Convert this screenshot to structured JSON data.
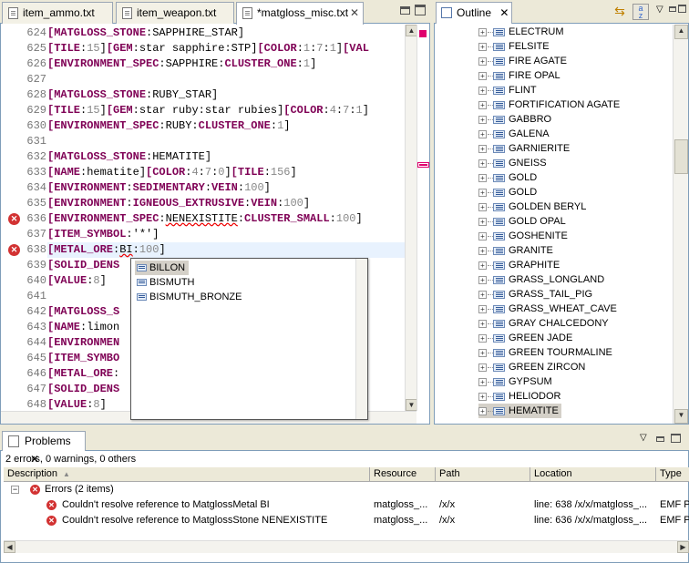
{
  "editor": {
    "tabs": [
      {
        "label": "item_ammo.txt"
      },
      {
        "label": "item_weapon.txt"
      },
      {
        "label": "*matgloss_misc.txt"
      }
    ],
    "lines": [
      {
        "n": "624",
        "html": "<span class=\"kw\">[MATGLOSS_STONE</span>:SAPPHIRE_STAR]"
      },
      {
        "n": "625",
        "html": "<span class=\"kw\">[TILE</span>:<span class=\"num\">15</span>]<span class=\"kw\">[GEM</span>:star sapphire:STP]<span class=\"kw\">[COLOR</span>:<span class=\"num\">1</span>:<span class=\"num\">7</span>:<span class=\"num\">1</span>]<span class=\"kw\">[VAL</span>"
      },
      {
        "n": "626",
        "html": "<span class=\"kw\">[ENVIRONMENT_SPEC</span>:SAPPHIRE:<span class=\"kw\">CLUSTER_ONE</span>:<span class=\"num\">1</span>]"
      },
      {
        "n": "627",
        "html": ""
      },
      {
        "n": "628",
        "html": "<span class=\"kw\">[MATGLOSS_STONE</span>:RUBY_STAR]"
      },
      {
        "n": "629",
        "html": "<span class=\"kw\">[TILE</span>:<span class=\"num\">15</span>]<span class=\"kw\">[GEM</span>:star ruby:star rubies]<span class=\"kw\">[COLOR</span>:<span class=\"num\">4</span>:<span class=\"num\">7</span>:<span class=\"num\">1</span>]"
      },
      {
        "n": "630",
        "html": "<span class=\"kw\">[ENVIRONMENT_SPEC</span>:RUBY:<span class=\"kw\">CLUSTER_ONE</span>:<span class=\"num\">1</span>]"
      },
      {
        "n": "631",
        "html": ""
      },
      {
        "n": "632",
        "html": "<span class=\"kw\">[MATGLOSS_STONE</span>:HEMATITE]"
      },
      {
        "n": "633",
        "html": "<span class=\"kw\">[NAME</span>:hematite]<span class=\"kw\">[COLOR</span>:<span class=\"num\">4</span>:<span class=\"num\">7</span>:<span class=\"num\">0</span>]<span class=\"kw\">[TILE</span>:<span class=\"num\">156</span>]"
      },
      {
        "n": "634",
        "html": "<span class=\"kw\">[ENVIRONMENT</span>:<span class=\"kw\">SEDIMENTARY</span>:<span class=\"kw\">VEIN</span>:<span class=\"num\">100</span>]"
      },
      {
        "n": "635",
        "html": "<span class=\"kw\">[ENVIRONMENT</span>:<span class=\"kw\">IGNEOUS_EXTRUSIVE</span>:<span class=\"kw\">VEIN</span>:<span class=\"num\">100</span>]"
      },
      {
        "n": "636",
        "html": "<span class=\"kw\">[ENVIRONMENT_SPEC</span>:<span class=\"err\">NENEXISTITE</span>:<span class=\"kw\">CLUSTER_SMALL</span>:<span class=\"num\">100</span>]",
        "error": true
      },
      {
        "n": "637",
        "html": "<span class=\"kw\">[ITEM_SYMBOL</span>:'*']"
      },
      {
        "n": "638",
        "html": "<span class=\"kw\">[METAL_ORE</span>:<span class=\"err\">BI</span>:<span class=\"num\">100</span>]",
        "error": true,
        "current": true
      },
      {
        "n": "639",
        "html": "<span class=\"kw\">[SOLID_DENS</span>"
      },
      {
        "n": "640",
        "html": "<span class=\"kw\">[VALUE</span>:<span class=\"num\">8</span>]"
      },
      {
        "n": "641",
        "html": ""
      },
      {
        "n": "642",
        "html": "<span class=\"kw\">[MATGLOSS_S</span>"
      },
      {
        "n": "643",
        "html": "<span class=\"kw\">[NAME</span>:limon"
      },
      {
        "n": "644",
        "html": "<span class=\"kw\">[ENVIRONMEN</span>"
      },
      {
        "n": "645",
        "html": "<span class=\"kw\">[ITEM_SYMBO</span>"
      },
      {
        "n": "646",
        "html": "<span class=\"kw\">[METAL_ORE</span>:"
      },
      {
        "n": "647",
        "html": "<span class=\"kw\">[SOLID_DENS</span>"
      },
      {
        "n": "648",
        "html": "<span class=\"kw\">[VALUE</span>:<span class=\"num\">8</span>]"
      }
    ],
    "assist": [
      "BILLON",
      "BISMUTH",
      "BISMUTH_BRONZE"
    ]
  },
  "outline": {
    "title": "Outline",
    "items": [
      "ELECTRUM",
      "FELSITE",
      "FIRE AGATE",
      "FIRE OPAL",
      "FLINT",
      "FORTIFICATION AGATE",
      "GABBRO",
      "GALENA",
      "GARNIERITE",
      "GNEISS",
      "GOLD",
      "GOLD",
      "GOLDEN BERYL",
      "GOLD OPAL",
      "GOSHENITE",
      "GRANITE",
      "GRAPHITE",
      "GRASS_LONGLAND",
      "GRASS_TAIL_PIG",
      "GRASS_WHEAT_CAVE",
      "GRAY CHALCEDONY",
      "GREEN JADE",
      "GREEN TOURMALINE",
      "GREEN ZIRCON",
      "GYPSUM",
      "HELIODOR",
      "HEMATITE"
    ],
    "selected_index": 26
  },
  "problems": {
    "title": "Problems",
    "summary": "2 errors, 0 warnings, 0 others",
    "columns": [
      "Description",
      "Resource",
      "Path",
      "Location",
      "Type"
    ],
    "group_label": "Errors (2 items)",
    "rows": [
      {
        "description": "Couldn't resolve reference to MatglossMetal BI",
        "resource": "matgloss_...",
        "path": "/x/x",
        "location": "line: 638 /x/x/matgloss_...",
        "type": "EMF P"
      },
      {
        "description": "Couldn't resolve reference to MatglossStone NENEXISTITE",
        "resource": "matgloss_...",
        "path": "/x/x",
        "location": "line: 636 /x/x/matgloss_...",
        "type": "EMF P"
      }
    ]
  },
  "colors": {
    "keyword": "#7F0055",
    "error": "#D23232",
    "selection": "#D4D0C8"
  }
}
